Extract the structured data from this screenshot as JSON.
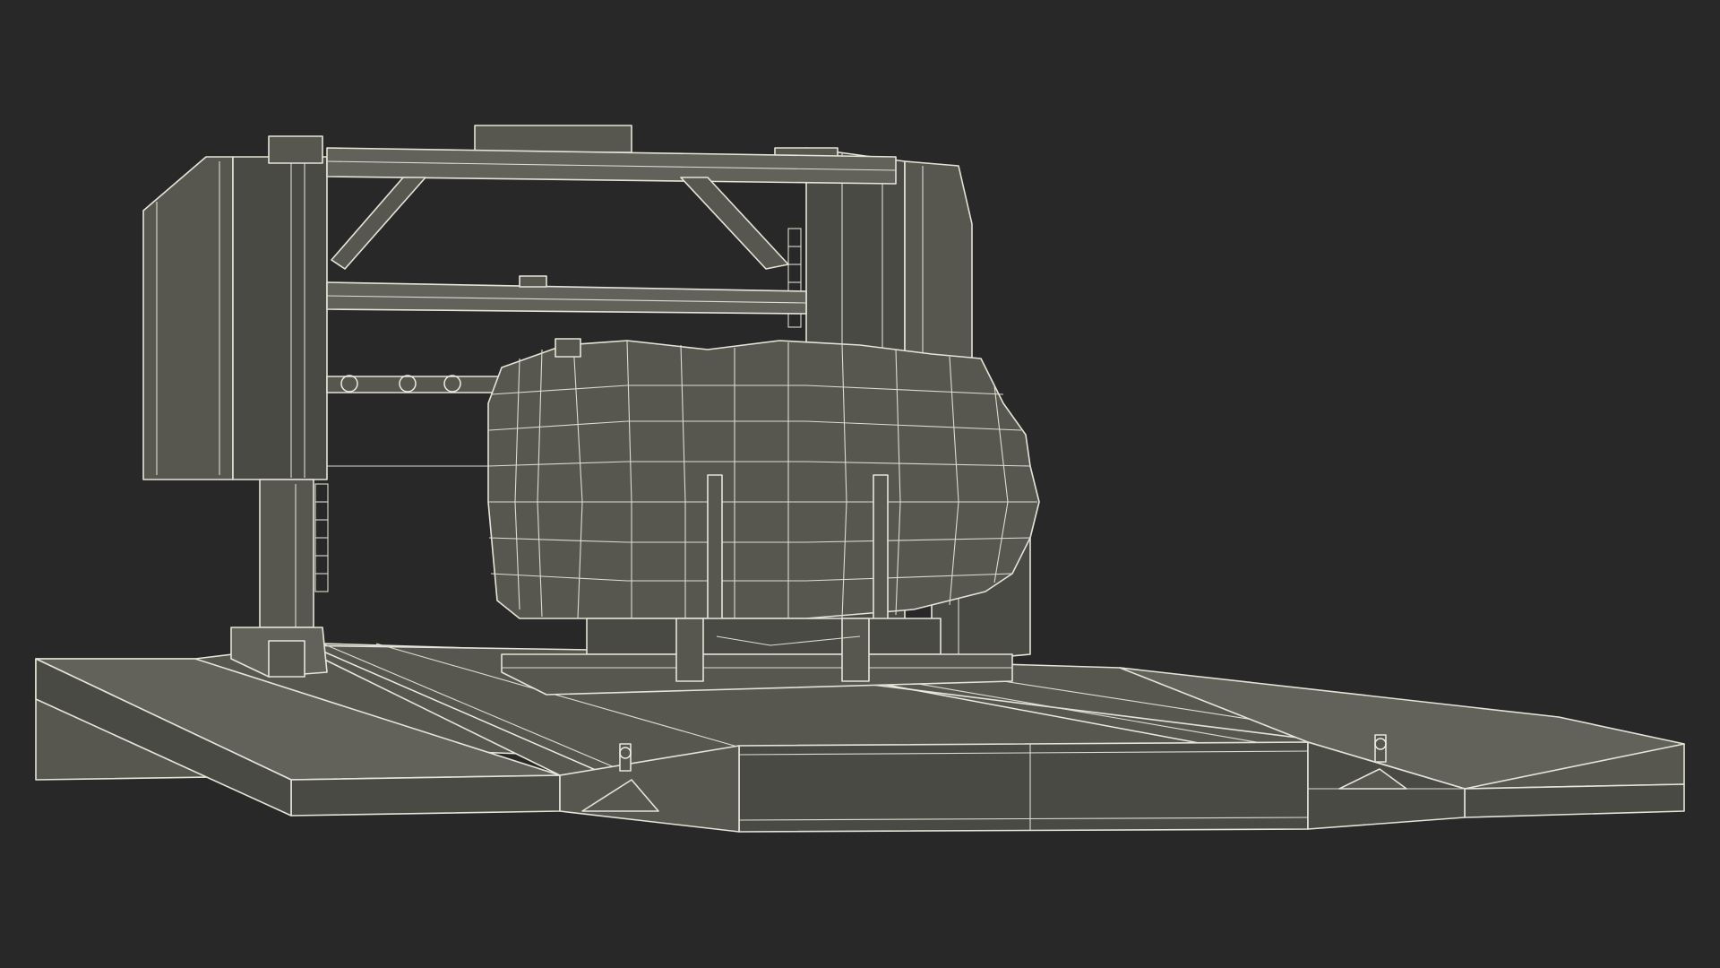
{
  "scene": {
    "background": "#282828",
    "fill_color": "#57574f",
    "edge_color": "#e4e4d8",
    "subject": "sawmill-wireframe-render",
    "components": [
      "left-tower",
      "right-tower",
      "top-crossbar",
      "middle-crossbar",
      "blade-arm",
      "log",
      "log-carriage",
      "rail-base",
      "left-platform",
      "right-platform"
    ]
  }
}
